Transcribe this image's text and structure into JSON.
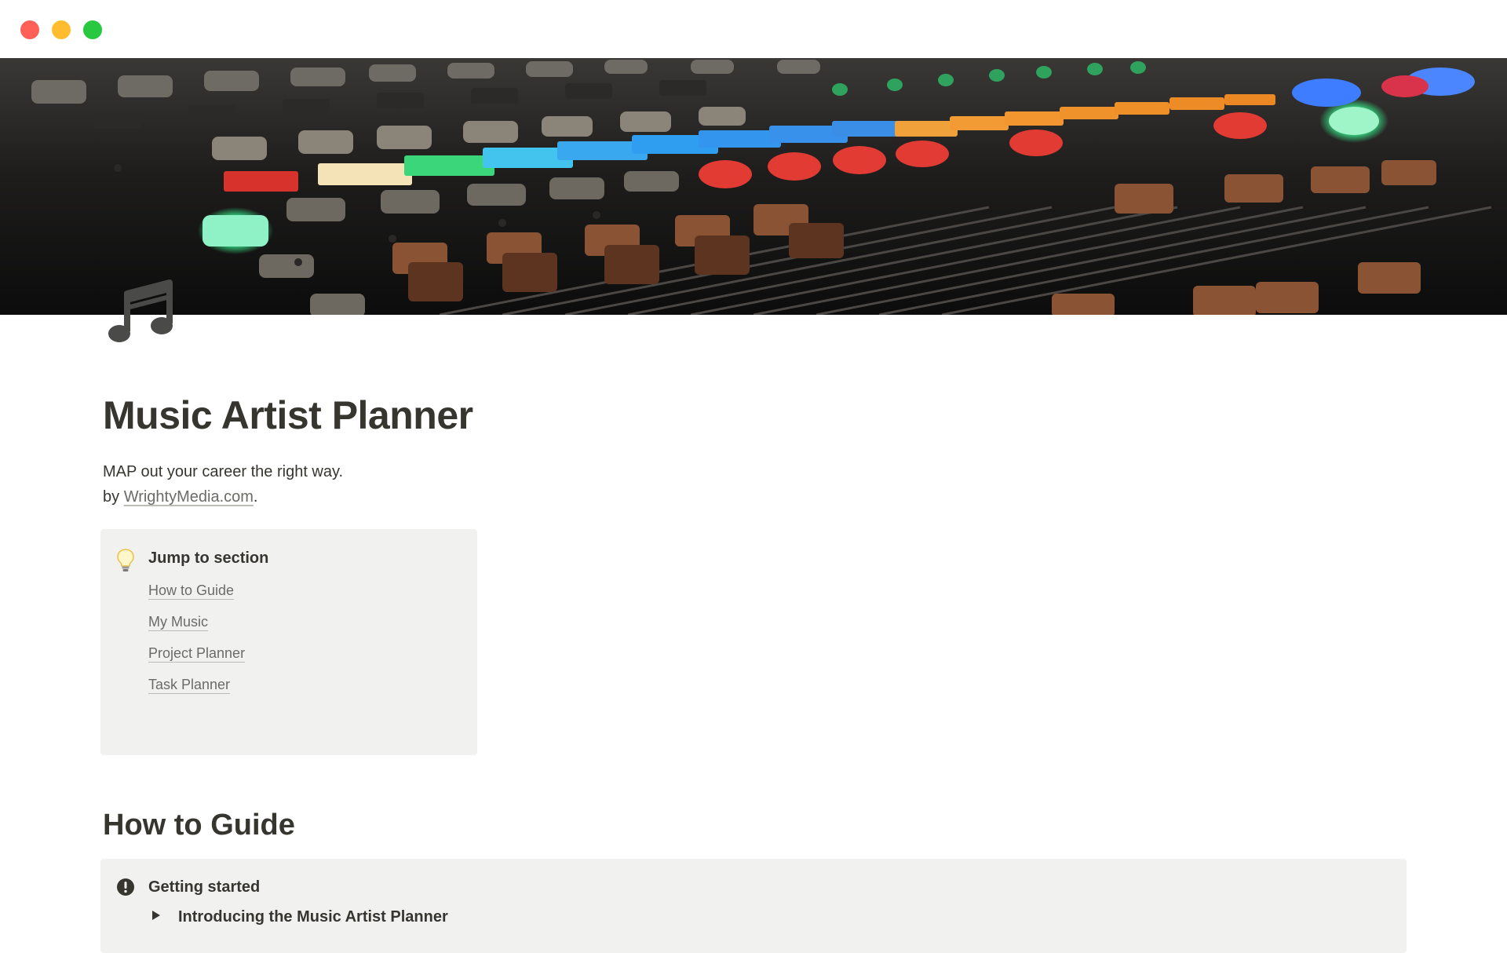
{
  "window": {
    "controls": [
      "close",
      "minimize",
      "maximize"
    ]
  },
  "cover": {
    "description_icon": "mixing-console-cover"
  },
  "page": {
    "icon": "music-note-icon",
    "title": "Music Artist Planner",
    "subtitle_line1": "MAP out your career the right way.",
    "byline_prefix": "by ",
    "byline_link": "WrightyMedia.com",
    "byline_suffix": "."
  },
  "jump_callout": {
    "icon": "lightbulb-icon",
    "title": "Jump to section",
    "links": [
      "How to Guide",
      "My Music",
      "Project Planner",
      "Task Planner"
    ]
  },
  "how_to": {
    "heading": "How to Guide",
    "callout": {
      "icon": "exclamation-icon",
      "title": "Getting started",
      "toggle_label": "Introducing the Music Artist Planner"
    }
  },
  "colors": {
    "text": "#37352f",
    "muted_link": "#6b6b67",
    "callout_bg": "#f1f1ef",
    "close": "#fe5f57",
    "minimize": "#febc2e",
    "maximize": "#28c840"
  }
}
